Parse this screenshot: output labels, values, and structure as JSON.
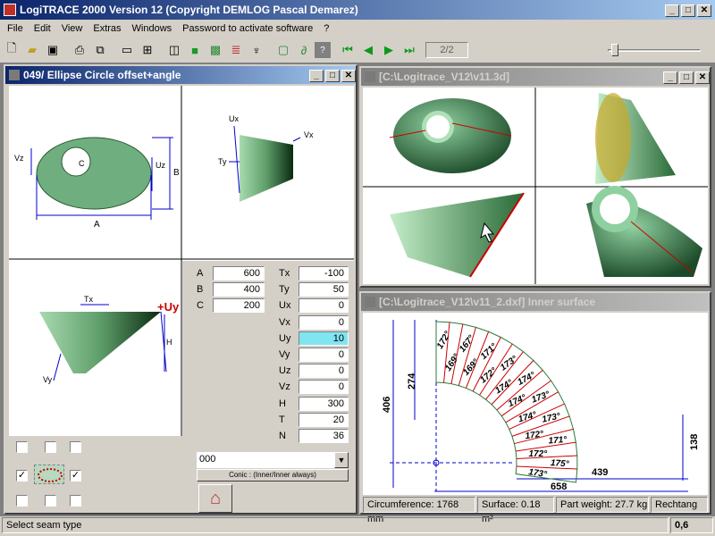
{
  "app": {
    "title": "LogiTRACE 2000  Version 12  (Copyright DEMLOG Pascal Demarez)"
  },
  "menu": [
    "File",
    "Edit",
    "View",
    "Extras",
    "Windows",
    "Password to activate software",
    "?"
  ],
  "toolbar": {
    "page_indicator": "2/2"
  },
  "left_window": {
    "title": "049/ Ellipse Circle offset+angle",
    "labels": {
      "vz": "Vz",
      "c": "C",
      "uz": "Uz",
      "b": "B",
      "a": "A",
      "ux": "Ux",
      "vx": "Vx",
      "ty": "Ty",
      "tx": "Tx",
      "uy": "+Uy",
      "h": "H",
      "vy": "Vy",
      "plus": "+",
      "minus": "-"
    },
    "params_left": [
      {
        "label": "A",
        "value": "600"
      },
      {
        "label": "B",
        "value": "400"
      },
      {
        "label": "C",
        "value": "200"
      }
    ],
    "params_right": [
      {
        "label": "Tx",
        "value": "-100"
      },
      {
        "label": "Ty",
        "value": "50"
      },
      {
        "label": "Ux",
        "value": "0"
      },
      {
        "label": "Vx",
        "value": "0"
      },
      {
        "label": "Uy",
        "value": "10"
      },
      {
        "label": "Vy",
        "value": "0"
      },
      {
        "label": "Uz",
        "value": "0"
      },
      {
        "label": "Vz",
        "value": "0"
      },
      {
        "label": "H",
        "value": "300"
      },
      {
        "label": "T",
        "value": "20"
      },
      {
        "label": "N",
        "value": "36"
      }
    ],
    "combo_value": "000",
    "conic_button": "Conic : (Inner/Inner always)"
  },
  "view3d_window": {
    "title": "[C:\\Logitrace_V12\\v11.3d]"
  },
  "dxf_window": {
    "title": "[C:\\Logitrace_V12\\v11_2.dxf]  Inner surface",
    "dims": {
      "d406": "406",
      "d274": "274",
      "d138": "138",
      "d439": "439",
      "d658": "658"
    },
    "angles": [
      "172°",
      "169°",
      "167°",
      "169°",
      "171°",
      "172°",
      "173°",
      "174°",
      "174°",
      "174°",
      "173°",
      "174°",
      "173°",
      "172°",
      "171°",
      "172°",
      "175°",
      "173°"
    ],
    "status": {
      "circumference": "Circumference: 1768 mm",
      "surface": "Surface: 0.18 m²",
      "weight": "Part weight: 27.7 kg",
      "shape": "Rechtang"
    }
  },
  "statusbar": {
    "message": "Select seam type",
    "value": "0,6"
  },
  "colors": {
    "shape_green": "#6fae7f",
    "dim_blue": "#0000cc",
    "seam_red": "#cc0000",
    "highlight": "#7fe5f0"
  }
}
